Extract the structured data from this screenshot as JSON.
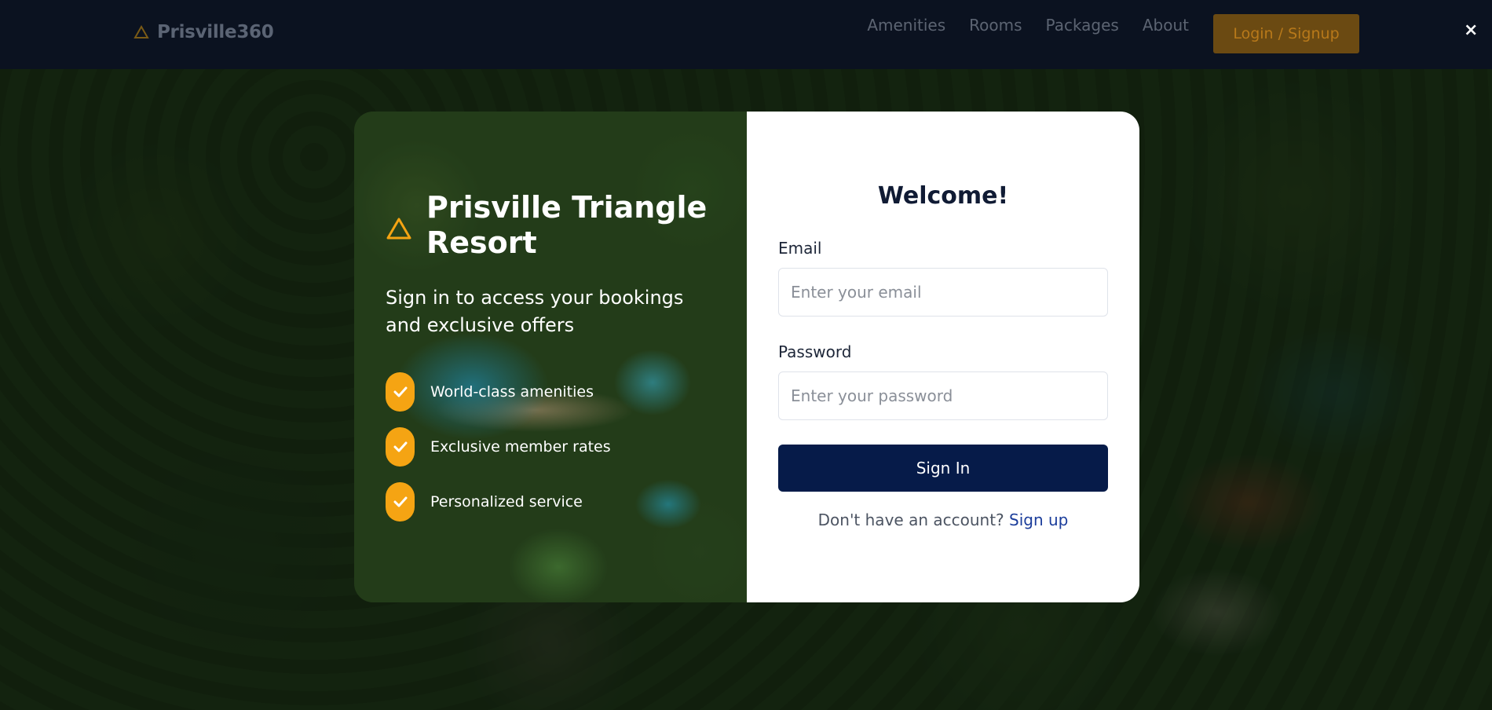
{
  "navbar": {
    "brand": "Prisville360",
    "links": [
      "Amenities",
      "Rooms",
      "Packages",
      "About"
    ],
    "login_label": "Login / Signup",
    "close_label": "×"
  },
  "modal": {
    "left": {
      "title": "Prisville Triangle Resort",
      "subtitle": "Sign in to access your bookings and exclusive offers",
      "features": [
        "World-class amenities",
        "Exclusive member rates",
        "Personalized service"
      ]
    },
    "right": {
      "heading": "Welcome!",
      "email_label": "Email",
      "email_placeholder": "Enter your email",
      "email_value": "",
      "password_label": "Password",
      "password_placeholder": "Enter your password",
      "password_value": "",
      "signin_label": "Sign In",
      "signup_prompt": "Don't have an account?",
      "signup_link": "Sign up"
    }
  },
  "colors": {
    "accent": "#f5a413",
    "primary": "#061b49",
    "link": "#1b3d9b"
  }
}
